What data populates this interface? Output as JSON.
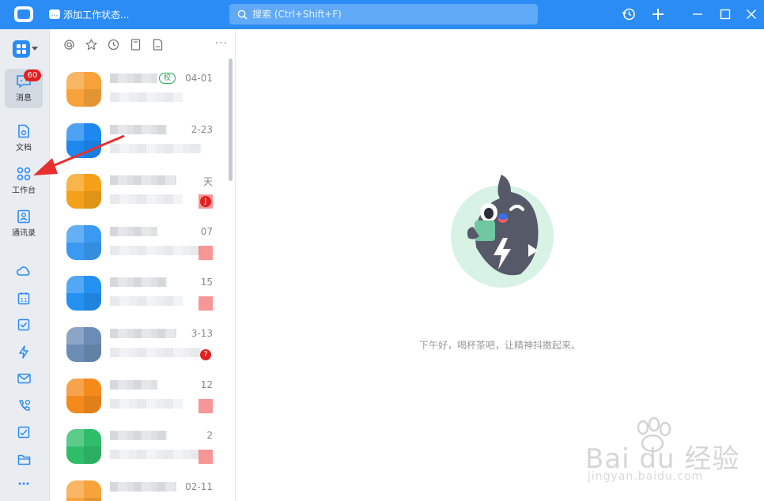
{
  "titlebar": {
    "status_label": "添加工作状态...",
    "search_placeholder": "搜索 (Ctrl+Shift+F)",
    "icons": [
      "history-icon",
      "plus-icon",
      "minimize-icon",
      "maximize-icon",
      "close-icon"
    ]
  },
  "sidebar": {
    "items": [
      {
        "label": "消息",
        "icon": "chat-icon",
        "badge": "60"
      },
      {
        "label": "文档",
        "icon": "doc-icon"
      },
      {
        "label": "工作台",
        "icon": "grid-icon"
      },
      {
        "label": "通讯录",
        "icon": "contacts-icon"
      }
    ],
    "bottom_icons": [
      "cloud-icon",
      "calendar-icon",
      "todo-icon",
      "lightning-icon",
      "mail-icon",
      "phone-icon",
      "approval-icon",
      "folder-icon",
      "more-icon"
    ],
    "calendar_day": "11"
  },
  "filters": {
    "icons": [
      "at-icon",
      "star-icon",
      "clock-icon",
      "bookmark-icon",
      "file-icon"
    ],
    "more": "···"
  },
  "conversations": [
    {
      "time": "04-01",
      "tag": "校",
      "avatar_color": "#f7a23a"
    },
    {
      "time": "2-23",
      "avatar_color": "#1e88f0"
    },
    {
      "time": "天",
      "badge": "J",
      "avatar_color": "#f5a01a"
    },
    {
      "time": "07",
      "avatar_color": "#3a9af3"
    },
    {
      "time": "15",
      "avatar_color": "#2390f2"
    },
    {
      "time": "3-13",
      "badge": "7",
      "avatar_color": "#6a8cb5"
    },
    {
      "time": "12",
      "avatar_color": "#f58a1c"
    },
    {
      "time": "2",
      "avatar_color": "#2fbd6a"
    },
    {
      "time": "02-11",
      "avatar_color": "#f7a23a"
    }
  ],
  "empty_state": {
    "message": "下午好，喝杯茶吧，让精神抖擞起来。"
  },
  "watermark": {
    "brand": "Bai du 经验",
    "url": "jingyan.baidu.com"
  },
  "colors": {
    "accent": "#2b8cf5",
    "badge": "#e02020",
    "annotation_arrow": "#e53030"
  }
}
